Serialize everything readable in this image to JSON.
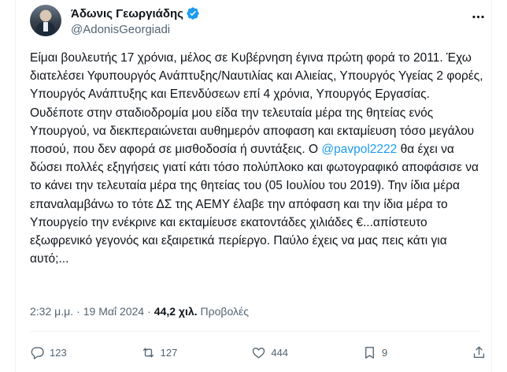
{
  "author": {
    "display_name": "Άδωνις Γεωργιάδης",
    "handle": "@AdonisGeorgiadi",
    "verified_icon": "verified-badge-icon",
    "verified_color": "#1d9bf0"
  },
  "tweet": {
    "text_before_mention": "Είμαι βουλευτής 17 χρόνια, μέλος σε Κυβέρνηση έγινα πρώτη φορά το 2011. Έχω διατελέσει Υφυπουργός Ανάπτυξης/Ναυτιλίας και Αλιείας, Υπουργός Υγείας 2 φορές, Υπουργός Ανάπτυξης και Επενδύσεων επί 4 χρόνια, Υπουργός Εργασίας.  Ουδέποτε στην σταδιοδρομία μου είδα την τελευταία μέρα της θητείας ενός Υπουργού, να διεκπεραιώνεται αυθημερόν αποφαση και εκταμίευση τόσο μεγάλου ποσού, που δεν αφορά σε μισθοδοσία ή συντάξεις. Ο ",
    "mention": "@pavpol2222",
    "text_after_mention": " θα έχει να δώσει πολλές εξηγήσεις γιατί κάτι τόσο πολύπλοκο και φωτογραφικό αποφάσισε να το κάνει την τελευταία μέρα της θητείας του (05 Ιουλίου του 2019). Την ίδια μέρα επαναλαμβάνω το τότε ΔΣ της ΑΕΜΥ έλαβε την απόφαση και την ίδια μέρα το Υπουργείο την ενέκρινε και εκταμίευσε εκατοντάδες χιλιάδες €...απίστευτο εξωφρενικό γεγονός και εξαιρετικά περίεργο. Παύλο έχεις να μας πεις κάτι για αυτό;..."
  },
  "meta": {
    "time": "2:32 μ.μ.",
    "separator": "·",
    "date": "19 Μαΐ 2024",
    "views_count": "44,2 χιλ.",
    "views_label": "Προβολές"
  },
  "actions": {
    "reply": {
      "icon": "reply-icon",
      "count": "123"
    },
    "retweet": {
      "icon": "retweet-icon",
      "count": "127"
    },
    "like": {
      "icon": "heart-icon",
      "count": "444"
    },
    "bookmark": {
      "icon": "bookmark-icon",
      "count": "9"
    },
    "share": {
      "icon": "share-icon"
    }
  },
  "colors": {
    "text_primary": "#0f1419",
    "text_secondary": "#536471",
    "link": "#1d9bf0",
    "border": "#eff3f4"
  }
}
